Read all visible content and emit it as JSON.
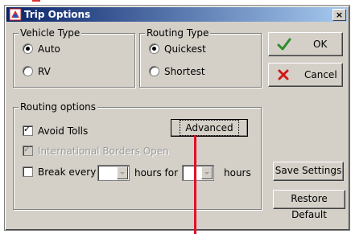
{
  "window": {
    "title": "Trip Options",
    "close_glyph": "×"
  },
  "vehicle_type": {
    "legend": "Vehicle Type",
    "options": [
      {
        "label": "Auto",
        "selected": true
      },
      {
        "label": "RV",
        "selected": false
      }
    ]
  },
  "routing_type": {
    "legend": "Routing Type",
    "options": [
      {
        "label": "Quickest",
        "selected": true
      },
      {
        "label": "Shortest",
        "selected": false
      }
    ]
  },
  "routing_options": {
    "legend": "Routing options",
    "avoid_tolls": {
      "label": "Avoid Tolls",
      "checked": true
    },
    "intl_borders": {
      "label": "International Borders Open",
      "checked": true,
      "disabled": true
    },
    "break_every": {
      "label": "Break every",
      "checked": false
    },
    "hours_for_label": "hours for",
    "hours_label": "hours",
    "advanced_button": "Advanced"
  },
  "buttons": {
    "ok": "OK",
    "cancel": "Cancel",
    "save_settings": "Save Settings",
    "restore_default": "Restore Default"
  },
  "colors": {
    "ok_check": "#2e8b2e",
    "cancel_x": "#d01818",
    "annotation": "#e0102a",
    "titlebar_start": "#0a246a",
    "titlebar_end": "#a6caf0"
  }
}
